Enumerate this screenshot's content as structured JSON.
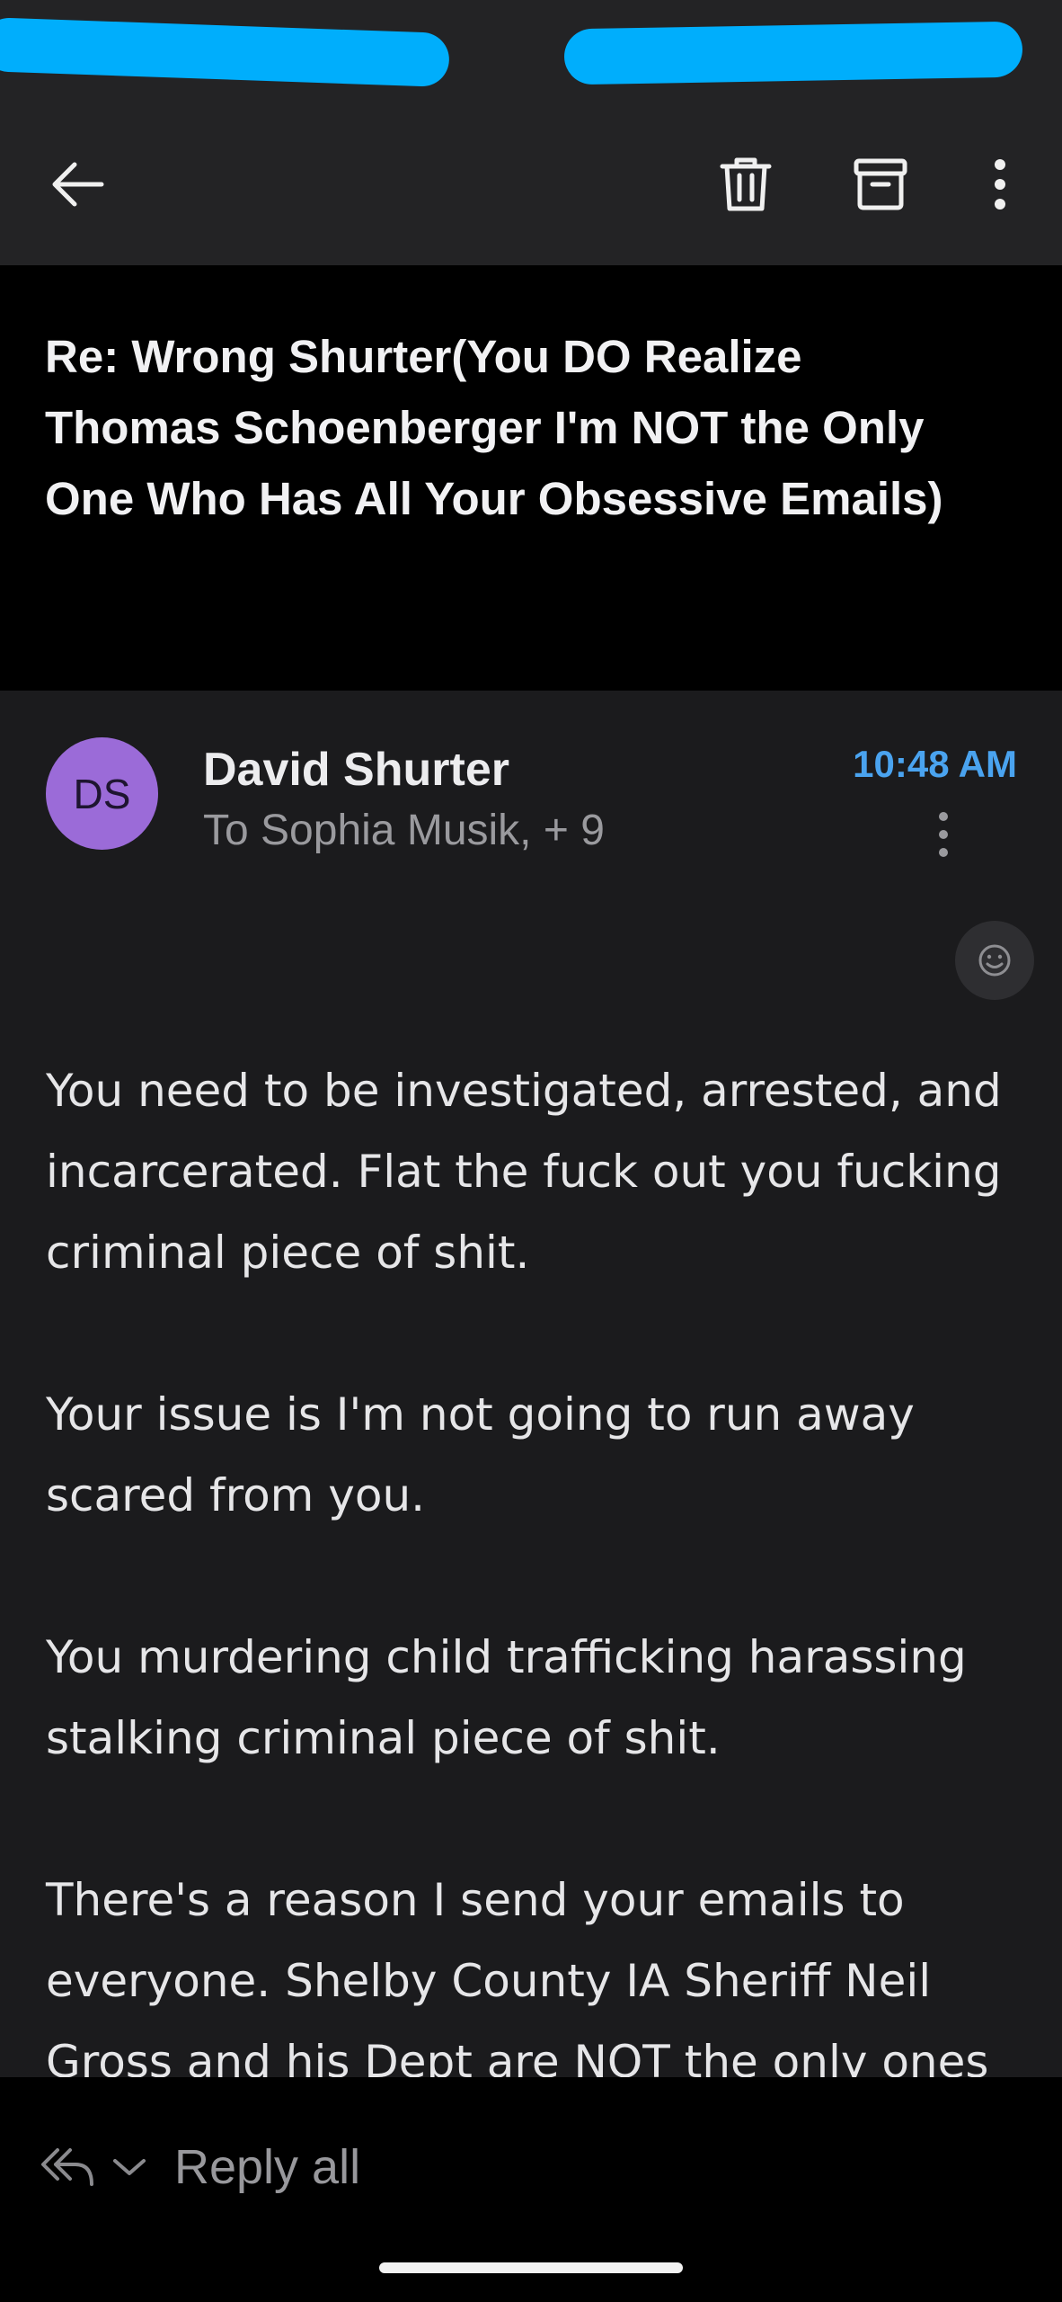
{
  "toolbar": {
    "back_icon": "arrow-left-icon",
    "delete_icon": "trash-icon",
    "archive_icon": "archive-icon",
    "more_icon": "more-vertical-icon"
  },
  "subject": "Re: Wrong Shurter(You DO Realize Thomas Schoenberger I'm NOT the Only One Who Has All Your Obsessive Emails)",
  "message": {
    "avatar_initials": "DS",
    "sender": "David Shurter",
    "recipients": "To Sophia Musik, + 9",
    "time": "10:48 AM",
    "paragraphs": [
      "You need to be investigated, arrested, and incarcerated. Flat the fuck out you fucking criminal piece of shit.",
      "Your issue is I'm not going to run away scared from you.",
      "You murdering child trafficking harassing stalking criminal piece of shit.",
      "There's a reason I send your emails to everyone. Shelby County IA Sheriff Neil Gross and his Dept are NOT the only ones"
    ]
  },
  "footer": {
    "reply_all_label": "Reply all"
  },
  "colors": {
    "accent": "#4aa3ef",
    "avatar": "#9b6bd8",
    "redaction": "#00aefc"
  }
}
